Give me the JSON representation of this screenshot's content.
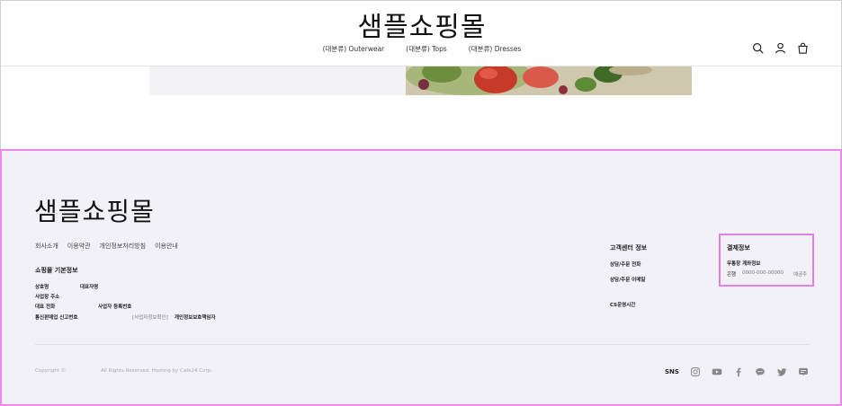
{
  "header": {
    "logo": "샘플쇼핑몰",
    "nav": [
      "(대분류) Outerwear",
      "(대분류) Tops",
      "(대분류) Dresses"
    ]
  },
  "icons": {
    "search": "search-icon",
    "account": "user-icon",
    "cart": "shopping-bag-icon"
  },
  "footer": {
    "logo": "샘플쇼핑몰",
    "links": [
      "회사소개",
      "이용약관",
      "개인정보처리방침",
      "이용안내"
    ],
    "shop_info": {
      "title": "쇼핑몰 기본정보",
      "company_name": "상호명",
      "ceo": "대표자명",
      "address": "사업장 주소",
      "phone": "대표 전화",
      "business_no": "사업자 등록번호",
      "ecommerce_no": "통신판매업 신고번호",
      "business_check": "[사업자정보확인]",
      "privacy_officer": "개인정보보호책임자"
    },
    "customer_center": {
      "title": "고객센터 정보",
      "phone": "상담/주문 전화",
      "email": "상담/주문 이메일",
      "hours": "CS운영시간"
    },
    "payment": {
      "title": "결제정보",
      "account_title": "무통장 계좌정보",
      "bank": "은행",
      "account_no": "0000-000-00000",
      "holder": "예금주"
    },
    "copyright": "Copyright ©",
    "rights": "All Rights Reserved. Hosting by Cafe24 Corp.",
    "sns_label": "SNS"
  }
}
